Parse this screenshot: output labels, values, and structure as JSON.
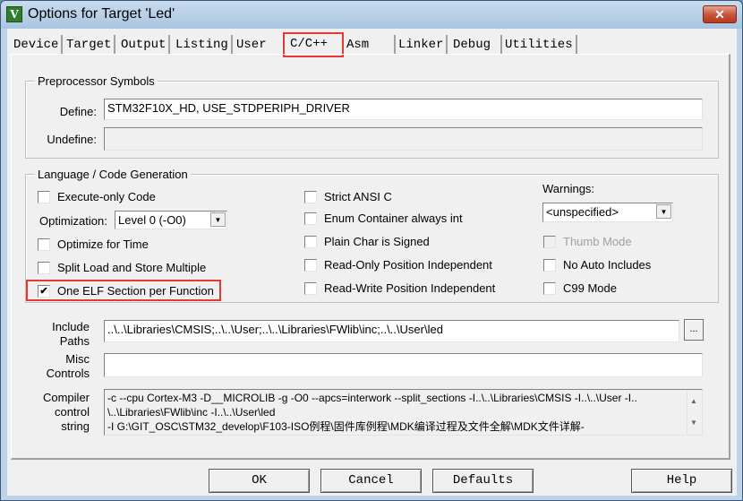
{
  "window": {
    "title": "Options for Target 'Led'",
    "icon": "keil-uvision-icon",
    "close_label": "✕"
  },
  "tabs": [
    {
      "label": "Device"
    },
    {
      "label": "Target"
    },
    {
      "label": "Output"
    },
    {
      "label": "Listing"
    },
    {
      "label": "User"
    },
    {
      "label": "C/C++",
      "active": true
    },
    {
      "label": "Asm"
    },
    {
      "label": "Linker"
    },
    {
      "label": "Debug"
    },
    {
      "label": "Utilities"
    }
  ],
  "preprocessor": {
    "group_label": "Preprocessor Symbols",
    "define_label": "Define:",
    "define_value": "STM32F10X_HD, USE_STDPERIPH_DRIVER",
    "undefine_label": "Undefine:",
    "undefine_value": ""
  },
  "language": {
    "group_label": "Language / Code Generation",
    "execute_only": {
      "label": "Execute-only Code",
      "checked": false
    },
    "optimization_label": "Optimization:",
    "optimization_value": "Level 0 (-O0)",
    "optimize_time": {
      "label": "Optimize for Time",
      "checked": false
    },
    "split_load": {
      "label": "Split Load and Store Multiple",
      "checked": false
    },
    "one_elf": {
      "label": "One ELF Section per Function",
      "checked": true
    },
    "strict_ansi": {
      "label": "Strict ANSI C",
      "checked": false
    },
    "enum_container": {
      "label": "Enum Container always int",
      "checked": false
    },
    "plain_char": {
      "label": "Plain Char is Signed",
      "checked": false
    },
    "ro_pi": {
      "label": "Read-Only Position Independent",
      "checked": false
    },
    "rw_pi": {
      "label": "Read-Write Position Independent",
      "checked": false
    },
    "warnings_label": "Warnings:",
    "warnings_value": "<unspecified>",
    "thumb_mode": {
      "label": "Thumb Mode",
      "checked": false,
      "disabled": true
    },
    "no_auto_includes": {
      "label": "No Auto Includes",
      "checked": false
    },
    "c99_mode": {
      "label": "C99 Mode",
      "checked": false
    },
    "check_mark": "✔"
  },
  "include_paths": {
    "label_line1": "Include",
    "label_line2": "Paths",
    "value": "..\\..\\Libraries\\CMSIS;..\\..\\User;..\\..\\Libraries\\FWlib\\inc;..\\..\\User\\led",
    "browse_label": "..."
  },
  "misc_controls": {
    "label_line1": "Misc",
    "label_line2": "Controls",
    "value": ""
  },
  "compiler_string": {
    "label_line1": "Compiler",
    "label_line2": "control",
    "label_line3": "string",
    "lines": [
      "-c --cpu Cortex-M3 -D__MICROLIB -g -O0 --apcs=interwork --split_sections -I..\\..\\Libraries\\CMSIS -I..\\..\\User -I..",
      "\\..\\Libraries\\FWlib\\inc -I..\\..\\User\\led",
      "-I G:\\GIT_OSC\\STM32_develop\\F103-ISO例程\\固件库例程\\MDK编译过程及文件全解\\MDK文件详解-"
    ],
    "scroll_up": "▲",
    "scroll_down": "▼"
  },
  "buttons": {
    "ok": "OK",
    "cancel": "Cancel",
    "defaults": "Defaults",
    "help": "Help"
  },
  "colors": {
    "highlight": "#e53935",
    "dialog_bg": "#f0f0f0",
    "titlebar": "#b5cce6"
  },
  "dropdown_arrow": "▼"
}
